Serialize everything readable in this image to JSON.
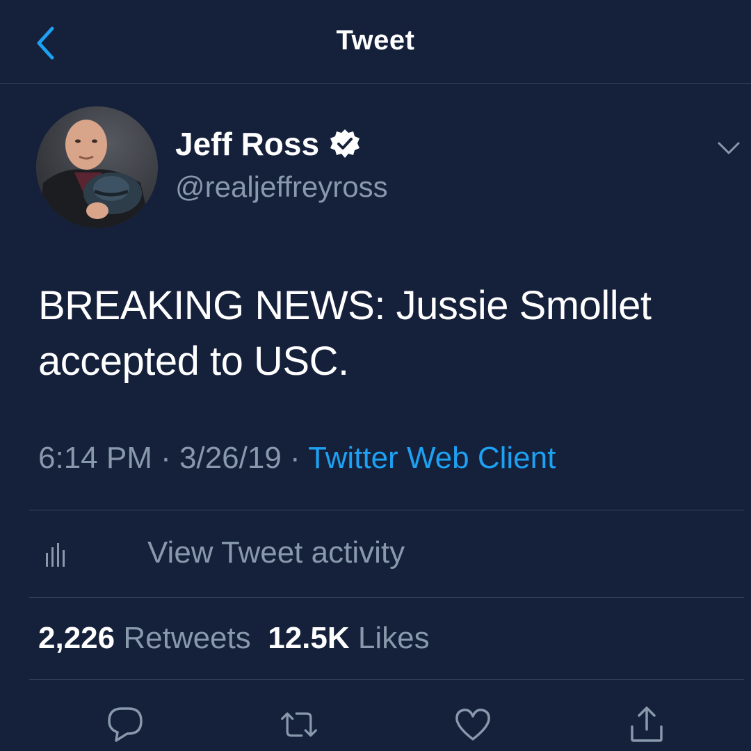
{
  "header": {
    "title": "Tweet",
    "back_icon": "chevron-left-icon",
    "back_color": "#1da1f2"
  },
  "author": {
    "display_name": "Jeff Ross",
    "verified": true,
    "handle": "@realjeffreyross"
  },
  "tweet": {
    "text": "BREAKING NEWS: Jussie Smollet accepted to USC.",
    "time": "6:14 PM",
    "separator": "·",
    "date": "3/26/19",
    "source": "Twitter Web Client"
  },
  "activity": {
    "label": "View Tweet activity",
    "icon": "bar-chart-icon"
  },
  "stats": {
    "retweets_count": "2,226",
    "retweets_label": "Retweets",
    "likes_count": "12.5K",
    "likes_label": "Likes"
  },
  "actions": [
    {
      "name": "reply",
      "icon": "reply-icon"
    },
    {
      "name": "retweet",
      "icon": "retweet-icon"
    },
    {
      "name": "like",
      "icon": "heart-icon"
    },
    {
      "name": "share",
      "icon": "share-icon"
    }
  ],
  "colors": {
    "background": "#15203b",
    "accent": "#1da1f2",
    "secondary_text": "#8899ac",
    "divider": "#38465e"
  }
}
